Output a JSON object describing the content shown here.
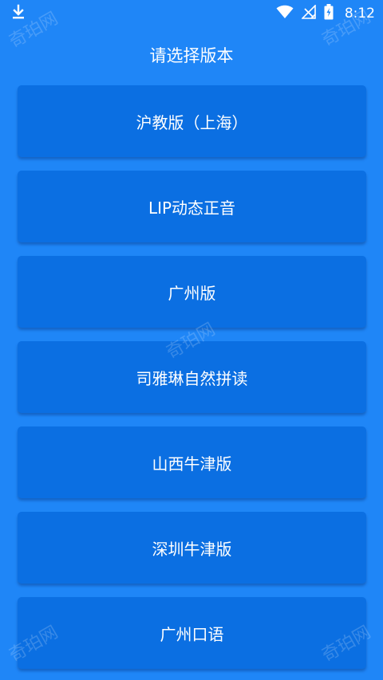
{
  "status_bar": {
    "time": "8:12",
    "icons": [
      "download-icon",
      "wifi-icon",
      "signal-icon",
      "battery-charging-icon"
    ]
  },
  "page": {
    "title": "请选择版本"
  },
  "versions": [
    {
      "label": "沪教版（上海）"
    },
    {
      "label": "LIP动态正音"
    },
    {
      "label": "广州版"
    },
    {
      "label": "司雅琳自然拼读"
    },
    {
      "label": "山西牛津版"
    },
    {
      "label": "深圳牛津版"
    },
    {
      "label": "广州口语"
    }
  ],
  "watermark": {
    "text": "奇珀网"
  },
  "colors": {
    "background": "#1f86f7",
    "button": "#0b6fe2",
    "text": "#ffffff"
  }
}
